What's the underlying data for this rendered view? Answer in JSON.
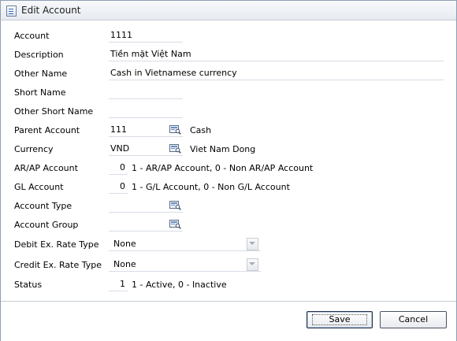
{
  "window": {
    "title": "Edit Account"
  },
  "form": {
    "account": {
      "label": "Account",
      "value": "1111"
    },
    "description": {
      "label": "Description",
      "value": "Tiền mặt Việt Nam"
    },
    "other_name": {
      "label": "Other Name",
      "value": "Cash in Vietnamese currency"
    },
    "short_name": {
      "label": "Short Name",
      "value": ""
    },
    "other_short_name": {
      "label": "Other Short Name",
      "value": ""
    },
    "parent_account": {
      "label": "Parent Account",
      "value": "111",
      "lookup_text": "Cash"
    },
    "currency": {
      "label": "Currency",
      "value": "VND",
      "lookup_text": "Viet Nam Dong"
    },
    "ar_ap_account": {
      "label": "AR/AP Account",
      "value": "0",
      "hint": "1 - AR/AP Account, 0 - Non AR/AP Account"
    },
    "gl_account": {
      "label": "GL Account",
      "value": "0",
      "hint": "1 - G/L Account, 0 - Non G/L Account"
    },
    "account_type": {
      "label": "Account Type",
      "value": ""
    },
    "account_group": {
      "label": "Account Group",
      "value": ""
    },
    "debit_rate_type": {
      "label": "Debit Ex. Rate Type",
      "value": "None"
    },
    "credit_rate_type": {
      "label": "Credit Ex. Rate Type",
      "value": "None"
    },
    "status": {
      "label": "Status",
      "value": "1",
      "hint": "1 - Active, 0 - Inactive"
    }
  },
  "buttons": {
    "save": "Save",
    "cancel": "Cancel"
  },
  "icons": {
    "title": "form-icon",
    "lookup": "lookup-icon",
    "dropdown": "chevron-down-icon"
  }
}
